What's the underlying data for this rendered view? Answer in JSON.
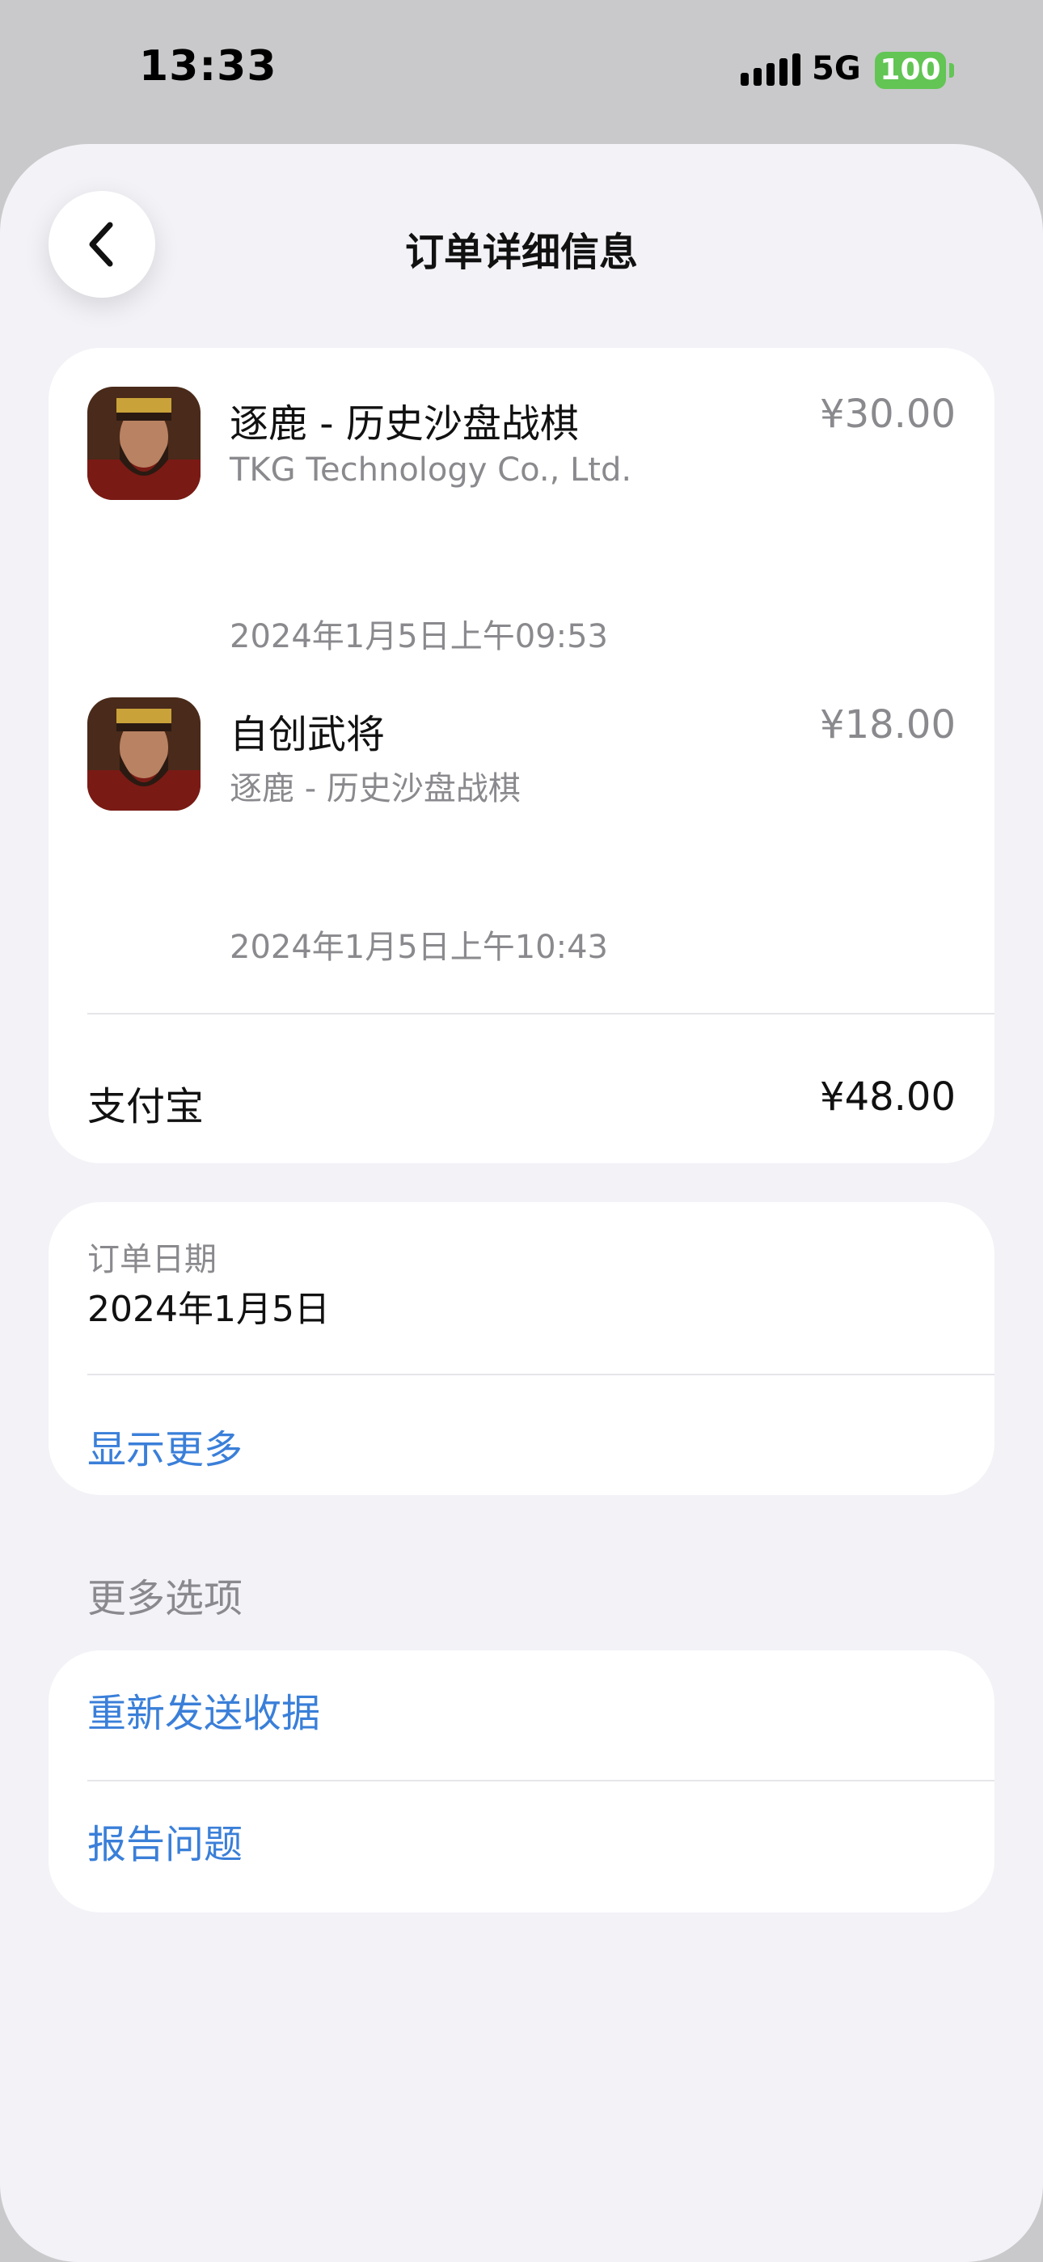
{
  "status_bar": {
    "time": "13:33",
    "network": "5G",
    "battery": "100"
  },
  "nav": {
    "title": "订单详细信息"
  },
  "items": [
    {
      "title": "逐鹿 - 历史沙盘战棋",
      "subtitle": "TKG Technology Co., Ltd.",
      "price": "¥30.00",
      "date": "2024年1月5日上午09:53"
    },
    {
      "title": "自创武将",
      "subtitle": "逐鹿 - 历史沙盘战棋",
      "price": "¥18.00",
      "date": "2024年1月5日上午10:43"
    }
  ],
  "payment": {
    "method": "支付宝",
    "total": "¥48.00"
  },
  "order": {
    "date_label": "订单日期",
    "date_value": "2024年1月5日",
    "show_more": "显示更多"
  },
  "more_options": {
    "header": "更多选项",
    "resend": "重新发送收据",
    "report": "报告问题"
  },
  "colors": {
    "accent": "#3a7fd9",
    "battery": "#62c554",
    "background": "#f2f2f7"
  }
}
